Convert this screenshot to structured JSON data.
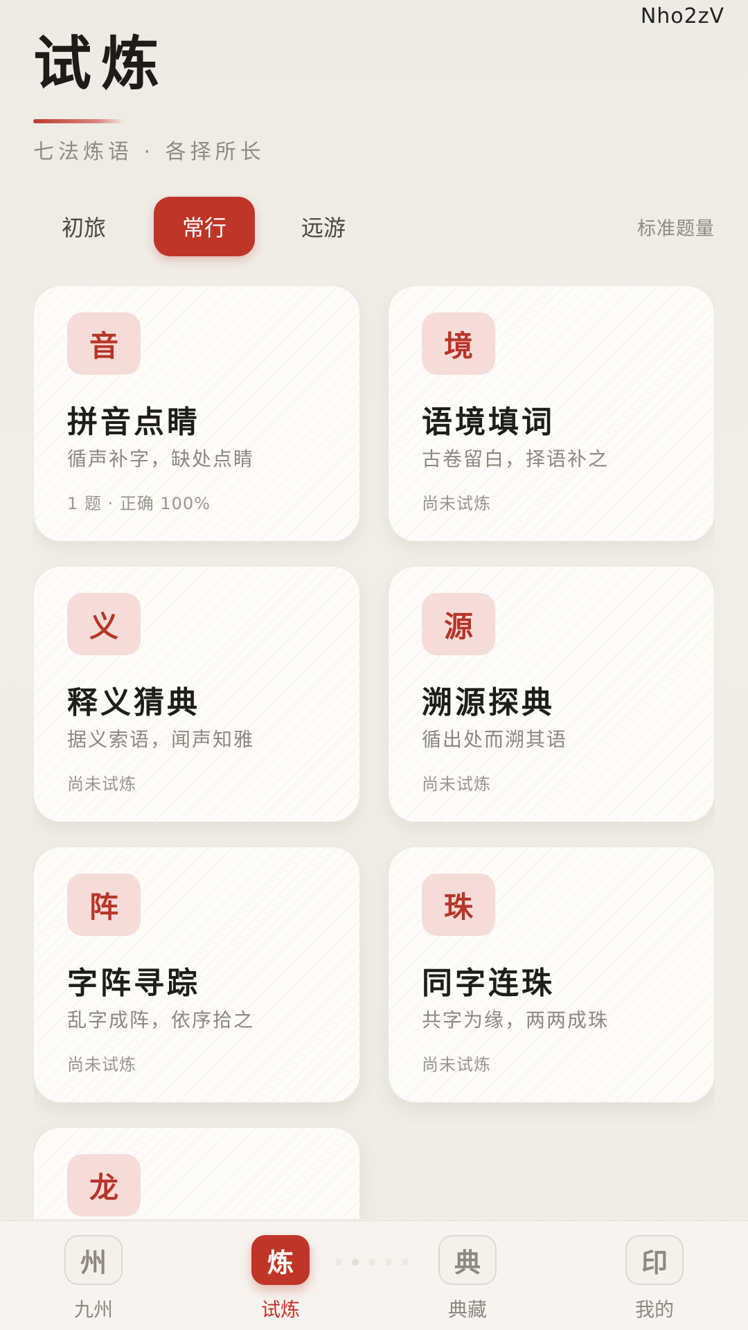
{
  "watermark": "Nho2zV",
  "header": {
    "title": "试炼",
    "subtitle": "七法炼语 · 各择所长"
  },
  "tabs": {
    "items": [
      {
        "label": "初旅",
        "active": false
      },
      {
        "label": "常行",
        "active": true
      },
      {
        "label": "远游",
        "active": false
      }
    ],
    "count_label": "标准题量"
  },
  "cards": [
    {
      "badge": "音",
      "title": "拼音点睛",
      "desc": "循声补字，缺处点睛",
      "stat": "1 题 · 正确 100%"
    },
    {
      "badge": "境",
      "title": "语境填词",
      "desc": "古卷留白，择语补之",
      "stat": "尚未试炼"
    },
    {
      "badge": "义",
      "title": "释义猜典",
      "desc": "据义索语，闻声知雅",
      "stat": "尚未试炼"
    },
    {
      "badge": "源",
      "title": "溯源探典",
      "desc": "循出处而溯其语",
      "stat": "尚未试炼"
    },
    {
      "badge": "阵",
      "title": "字阵寻踪",
      "desc": "乱字成阵，依序拾之",
      "stat": "尚未试炼"
    },
    {
      "badge": "珠",
      "title": "同字连珠",
      "desc": "共字为缘，两两成珠",
      "stat": "尚未试炼"
    },
    {
      "badge": "龙",
      "title": "",
      "desc": "",
      "stat": ""
    }
  ],
  "nav": {
    "items": [
      {
        "icon": "州",
        "label": "九州",
        "active": false
      },
      {
        "icon": "炼",
        "label": "试炼",
        "active": true
      },
      {
        "icon": "典",
        "label": "典藏",
        "active": false
      },
      {
        "icon": "印",
        "label": "我的",
        "active": false
      }
    ]
  },
  "colors": {
    "accent": "#bf3628",
    "badge_bg": "#f5dcd8",
    "background": "#efebe5"
  }
}
